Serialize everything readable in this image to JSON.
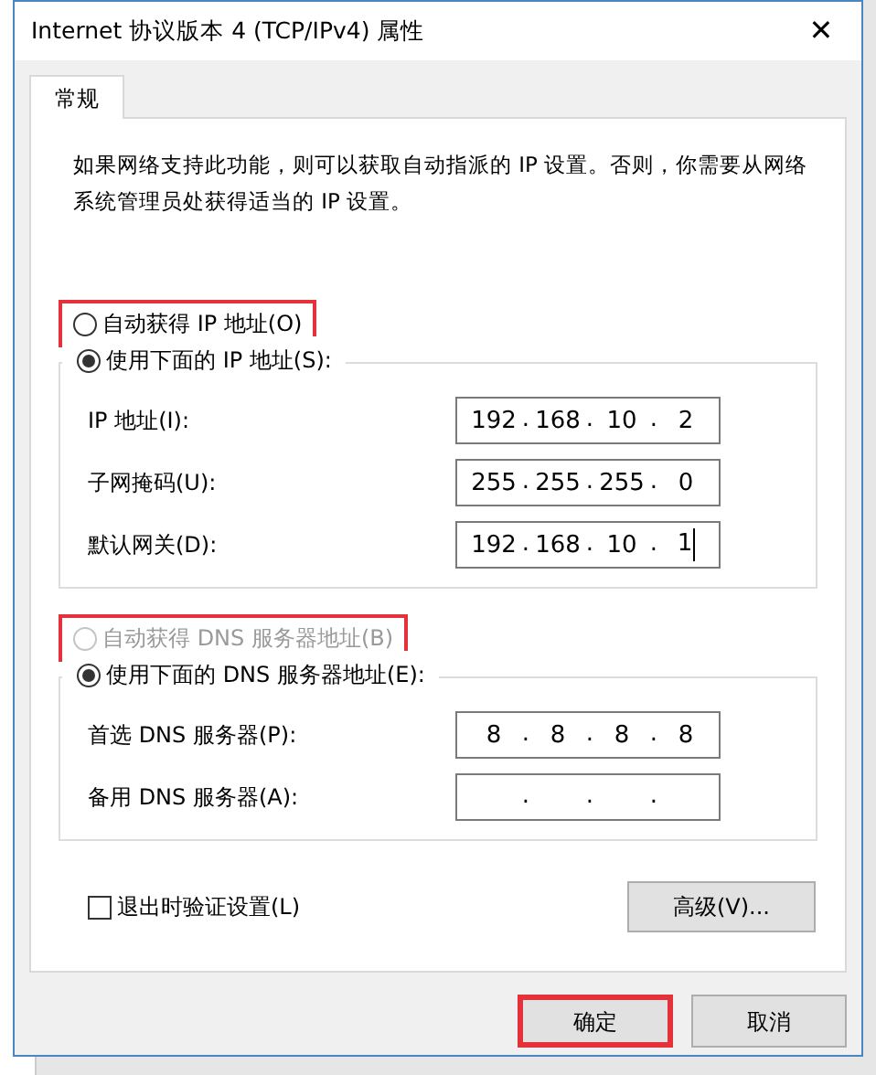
{
  "window": {
    "title": "Internet 协议版本 4 (TCP/IPv4) 属性",
    "close": "✕"
  },
  "tabs": [
    {
      "label": "常规",
      "selected": true
    }
  ],
  "description": "如果网络支持此功能，则可以获取自动指派的 IP 设置。否则，你需要从网络系统管理员处获得适当的 IP 设置。",
  "ip_mode": [
    {
      "label": "自动获得 IP 地址(O)",
      "selected": false,
      "disabled": false,
      "highlighted": true
    },
    {
      "label": "使用下面的 IP 地址(S):",
      "selected": true,
      "disabled": false,
      "highlighted": false
    }
  ],
  "ip_fields": [
    {
      "label": "IP 地址(I):",
      "octets": [
        "192",
        "168",
        "10",
        "2"
      ],
      "separator": ".",
      "focused": false
    },
    {
      "label": "子网掩码(U):",
      "octets": [
        "255",
        "255",
        "255",
        "0"
      ],
      "separator": ".",
      "focused": false
    },
    {
      "label": "默认网关(D):",
      "octets": [
        "192",
        "168",
        "10",
        "1"
      ],
      "separator": ".",
      "focused": true
    }
  ],
  "dns_mode": [
    {
      "label": "自动获得 DNS 服务器地址(B)",
      "selected": false,
      "disabled": true,
      "highlighted": true
    },
    {
      "label": "使用下面的 DNS 服务器地址(E):",
      "selected": true,
      "disabled": false,
      "highlighted": false
    }
  ],
  "dns_fields": [
    {
      "label": "首选 DNS 服务器(P):",
      "octets": [
        "8",
        "8",
        "8",
        "8"
      ],
      "separator": ".",
      "focused": false
    },
    {
      "label": "备用 DNS 服务器(A):",
      "separator": ".",
      "focused": false
    }
  ],
  "validate_on_exit": {
    "label": "退出时验证设置(L)",
    "checked": false
  },
  "advanced_button": "高级(V)...",
  "buttons": [
    {
      "label": "确定",
      "highlighted": true
    },
    {
      "label": "取消",
      "highlighted": false
    }
  ]
}
